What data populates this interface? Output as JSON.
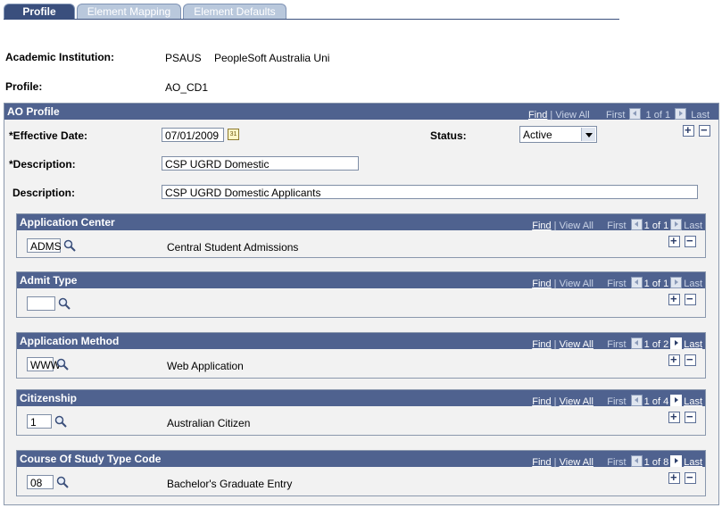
{
  "tabs": [
    {
      "label": "Profile"
    },
    {
      "label": "Element Mapping"
    },
    {
      "label": "Element Defaults"
    }
  ],
  "header": {
    "institution_label": "Academic Institution:",
    "institution_code": "PSAUS",
    "institution_name": "PeopleSoft Australia Uni",
    "profile_label": "Profile:",
    "profile_value": "AO_CD1"
  },
  "nav_text": {
    "find": "Find",
    "sep": " | ",
    "view_all": "View All",
    "first": "First",
    "last": "Last"
  },
  "ao_profile": {
    "title": "AO Profile",
    "counter": "1 of 1",
    "effective_date_label": "*Effective Date:",
    "effective_date": "07/01/2009",
    "status_label": "Status:",
    "status_value": "Active",
    "description_req_label": "*Description:",
    "description_short": "CSP UGRD Domestic",
    "description_label": "Description:",
    "description_long": "CSP UGRD Domestic Applicants"
  },
  "groups": [
    {
      "title": "Application Center",
      "counter": "1 of 1",
      "code": "ADMS",
      "description": "Central Student Admissions",
      "has_next": false
    },
    {
      "title": "Admit Type",
      "counter": "1 of 1",
      "code": "",
      "description": "",
      "has_next": false
    },
    {
      "title": "Application Method",
      "counter": "1 of 2",
      "code": "WWW",
      "description": "Web Application",
      "has_next": true
    },
    {
      "title": "Citizenship",
      "counter": "1 of 4",
      "code": "1",
      "description": "Australian Citizen",
      "has_next": true
    },
    {
      "title": "Course Of Study Type Code",
      "counter": "1 of 8",
      "code": "08",
      "description": "Bachelor's Graduate Entry",
      "has_next": true
    }
  ],
  "icons": {
    "lookup": "magnifier-icon",
    "calendar": "calendar-icon",
    "add": "plus-icon",
    "delete": "minus-icon"
  },
  "colors": {
    "header_bar": "#4f628f",
    "active_tab": "#3a4f7d",
    "inactive_tab": "#b9c8dc",
    "group_bg": "#f2f2f2"
  }
}
